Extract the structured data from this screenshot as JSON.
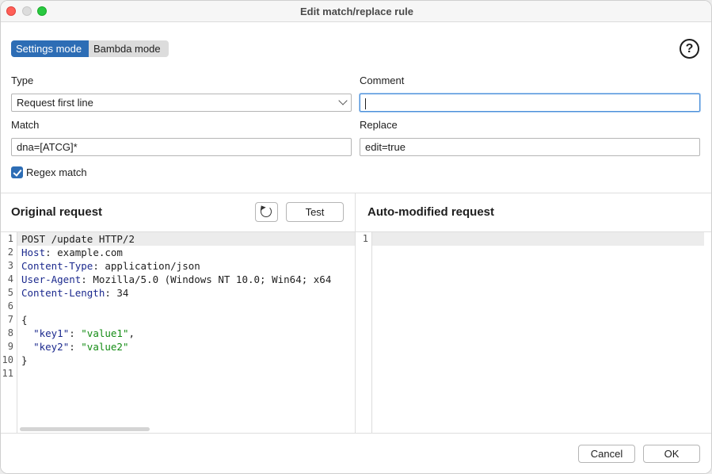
{
  "window": {
    "title": "Edit match/replace rule"
  },
  "modes": {
    "settings": "Settings mode",
    "bambda": "Bambda mode"
  },
  "help": {
    "glyph": "?"
  },
  "form": {
    "type_label": "Type",
    "type_value": "Request first line",
    "comment_label": "Comment",
    "comment_value": "",
    "match_label": "Match",
    "match_value": "dna=[ATCG]*",
    "replace_label": "Replace",
    "replace_value": "edit=true",
    "regex_label": "Regex match",
    "regex_checked": true
  },
  "original": {
    "title": "Original request",
    "test_label": "Test",
    "line_numbers": [
      "1",
      "2",
      "3",
      "4",
      "5",
      "6",
      "7",
      "8",
      "9",
      "10",
      "11"
    ]
  },
  "modified": {
    "title": "Auto-modified request",
    "line_numbers": [
      "1"
    ]
  },
  "footer": {
    "cancel_label": "Cancel",
    "ok_label": "OK"
  },
  "colors": {
    "accent": "#2d6db5",
    "header_key": "#1c2a8e",
    "string": "#148c14"
  }
}
